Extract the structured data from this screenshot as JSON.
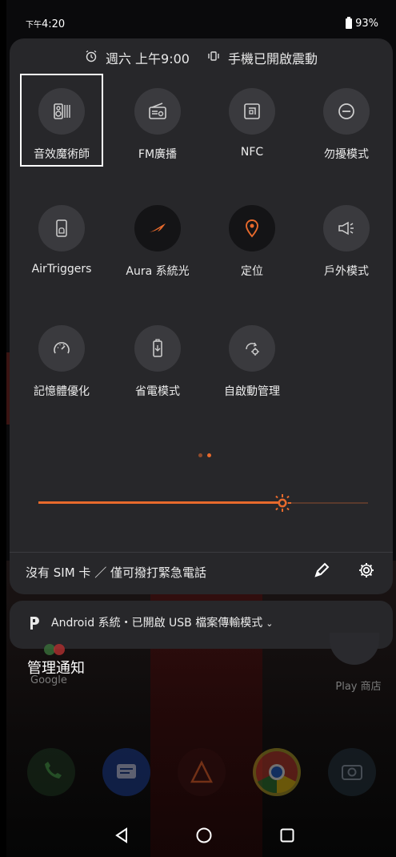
{
  "status_bar": {
    "ampm": "下午",
    "time": "4:20",
    "battery": "93%"
  },
  "qs_header": {
    "alarm": "週六 上午9:00",
    "vibrate": "手機已開啟震動"
  },
  "tiles": [
    {
      "label": "音效魔術師",
      "icon": "audio-wizard-icon"
    },
    {
      "label": "FM廣播",
      "icon": "radio-icon"
    },
    {
      "label": "NFC",
      "icon": "nfc-icon"
    },
    {
      "label": "勿擾模式",
      "icon": "do-not-disturb-icon"
    },
    {
      "label": "AirTriggers",
      "icon": "airtriggers-icon"
    },
    {
      "label": "Aura 系統光",
      "icon": "aura-rog-icon"
    },
    {
      "label": "定位",
      "icon": "location-icon"
    },
    {
      "label": "戶外模式",
      "icon": "outdoor-mode-icon"
    },
    {
      "label": "記憶體優化",
      "icon": "memory-optimize-icon"
    },
    {
      "label": "省電模式",
      "icon": "battery-saver-icon"
    },
    {
      "label": "自啟動管理",
      "icon": "auto-start-icon"
    }
  ],
  "brightness": {
    "level": 0.74
  },
  "qs_footer": {
    "sim_text": "沒有 SIM 卡 ／ 僅可撥打緊急電話"
  },
  "notification": {
    "text": "Android 系統・已開啟 USB 檔案傳輸模式"
  },
  "manage_notifications": "管理通知",
  "home_apps": {
    "google": "Google",
    "play_store": "Play 商店"
  },
  "colors": {
    "accent": "#e86a2c",
    "panel": "#27272a",
    "tile_bg": "#3a3a3e"
  }
}
